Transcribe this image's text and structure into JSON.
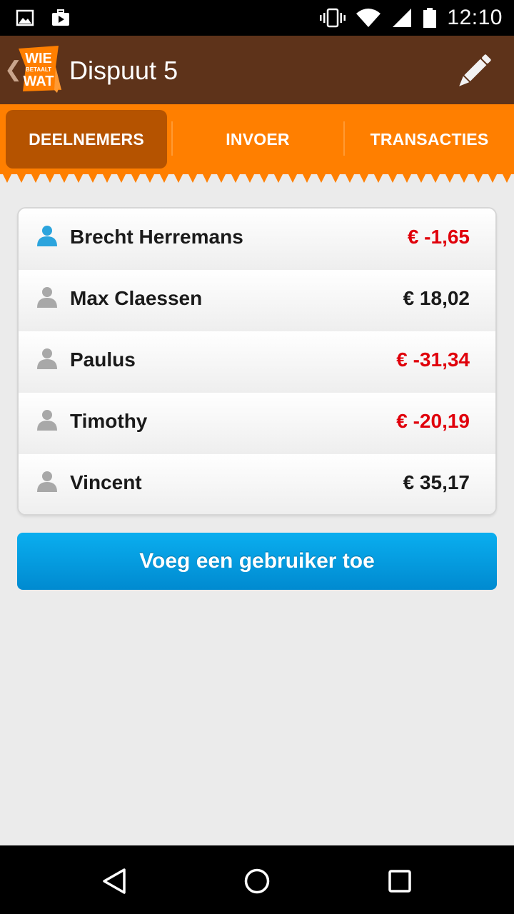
{
  "status_bar": {
    "time": "12:10",
    "icons": [
      "image-notification-icon",
      "media-notification-icon",
      "vibrate-icon",
      "wifi-icon",
      "signal-icon",
      "battery-icon"
    ]
  },
  "action_bar": {
    "back_glyph": "❮",
    "logo": {
      "line1": "WIE",
      "line2": "BETAALT",
      "line3": "WAT"
    },
    "title": "Dispuut 5",
    "edit_icon": "pencil-icon"
  },
  "tabs": [
    {
      "label": "DEELNEMERS",
      "active": true
    },
    {
      "label": "INVOER",
      "active": false
    },
    {
      "label": "TRANSACTIES",
      "active": false
    }
  ],
  "participants": [
    {
      "name": "Brecht Herremans",
      "amount": "€ -1,65",
      "negative": true,
      "current_user": true
    },
    {
      "name": "Max Claessen",
      "amount": "€ 18,02",
      "negative": false,
      "current_user": false
    },
    {
      "name": "Paulus",
      "amount": "€ -31,34",
      "negative": true,
      "current_user": false
    },
    {
      "name": "Timothy",
      "amount": "€ -20,19",
      "negative": true,
      "current_user": false
    },
    {
      "name": "Vincent",
      "amount": "€ 35,17",
      "negative": false,
      "current_user": false
    }
  ],
  "add_user_button": {
    "label": "Voeg een gebruiker toe"
  },
  "colors": {
    "action_bar": "#5e331a",
    "tab_bar": "#ff7f00",
    "tab_active": "#b55300",
    "negative_amount": "#e0000b",
    "positive_amount": "#1a1a1a",
    "button": "#009ee0",
    "avatar_self": "#2ba4dd",
    "avatar_other": "#a8a8a8"
  },
  "nav_bar": {
    "buttons": [
      "back-nav-icon",
      "home-nav-icon",
      "recents-nav-icon"
    ]
  }
}
